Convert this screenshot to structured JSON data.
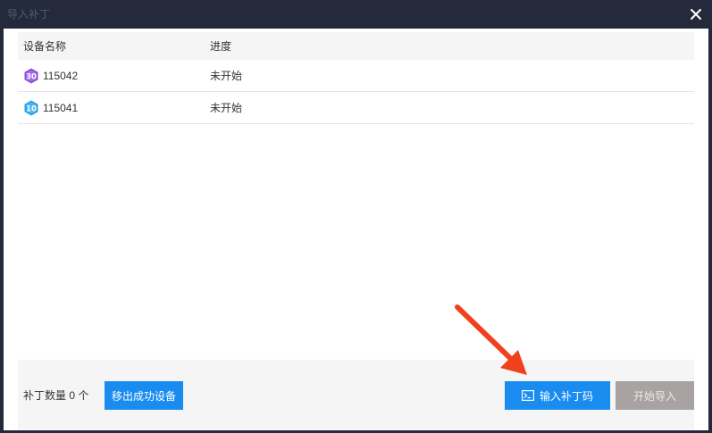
{
  "window": {
    "title": "导入补丁"
  },
  "table": {
    "columns": [
      "设备名称",
      "进度"
    ],
    "rows": [
      {
        "badge": "30",
        "badge_color": "#8a4fd6",
        "device": "115042",
        "status": "未开始"
      },
      {
        "badge": "10",
        "badge_color": "#2a9fe8",
        "device": "115041",
        "status": "未开始"
      }
    ]
  },
  "footer": {
    "patch_count_label": "补丁数量 0 个",
    "remove_success_label": "移出成功设备",
    "enter_patch_code_label": "输入补丁码",
    "start_import_label": "开始导入"
  },
  "colors": {
    "accent": "#1a8cf0",
    "disabled": "#a9a2a2",
    "annotation_arrow": "#f0401c",
    "titlebar": "#242a3c"
  },
  "icons": {
    "close": "close-icon",
    "terminal": "terminal-icon",
    "annotation": "red-arrow-annotation"
  }
}
